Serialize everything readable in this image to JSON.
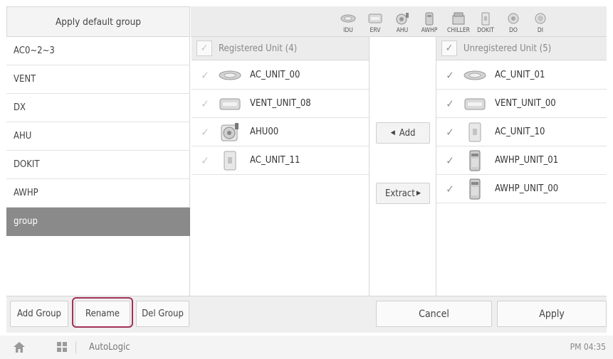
{
  "header": {
    "apply_default_group": "Apply default group",
    "unit_types": [
      {
        "label": "IDU",
        "icon": "idu-icon"
      },
      {
        "label": "ERV",
        "icon": "erv-icon"
      },
      {
        "label": "AHU",
        "icon": "ahu-icon"
      },
      {
        "label": "AWHP",
        "icon": "awhp-icon"
      },
      {
        "label": "CHILLER",
        "icon": "chiller-icon"
      },
      {
        "label": "DOKIT",
        "icon": "dokit-icon"
      },
      {
        "label": "DO",
        "icon": "do-icon"
      },
      {
        "label": "DI",
        "icon": "di-icon"
      }
    ]
  },
  "groups": [
    {
      "label": "AC0~2~3",
      "selected": false
    },
    {
      "label": "VENT",
      "selected": false
    },
    {
      "label": "DX",
      "selected": false
    },
    {
      "label": "AHU",
      "selected": false
    },
    {
      "label": "DOKIT",
      "selected": false
    },
    {
      "label": "AWHP",
      "selected": false
    },
    {
      "label": "group",
      "selected": true
    }
  ],
  "registered": {
    "header": "Registered Unit (4)",
    "units": [
      {
        "name": "AC_UNIT_00",
        "icon": "idu-icon"
      },
      {
        "name": "VENT_UNIT_08",
        "icon": "erv-icon"
      },
      {
        "name": "AHU00",
        "icon": "ahu-icon"
      },
      {
        "name": "AC_UNIT_11",
        "icon": "dokit-icon"
      }
    ]
  },
  "unregistered": {
    "header": "Unregistered Unit (5)",
    "units": [
      {
        "name": "AC_UNIT_01",
        "icon": "idu-icon"
      },
      {
        "name": "VENT_UNIT_00",
        "icon": "erv-icon"
      },
      {
        "name": "AC_UNIT_10",
        "icon": "dokit-icon"
      },
      {
        "name": "AWHP_UNIT_01",
        "icon": "awhp-icon"
      },
      {
        "name": "AWHP_UNIT_00",
        "icon": "awhp-icon"
      }
    ]
  },
  "actions": {
    "add": "Add",
    "extract": "Extract"
  },
  "bottom": {
    "add_group": "Add Group",
    "rename": "Rename",
    "del_group": "Del Group",
    "cancel": "Cancel",
    "apply": "Apply"
  },
  "status_bar": {
    "app_name": "AutoLogic",
    "time": "PM 04:35"
  },
  "colors": {
    "selected_group": "#8a8a8a",
    "highlight_border": "#a3315a"
  }
}
